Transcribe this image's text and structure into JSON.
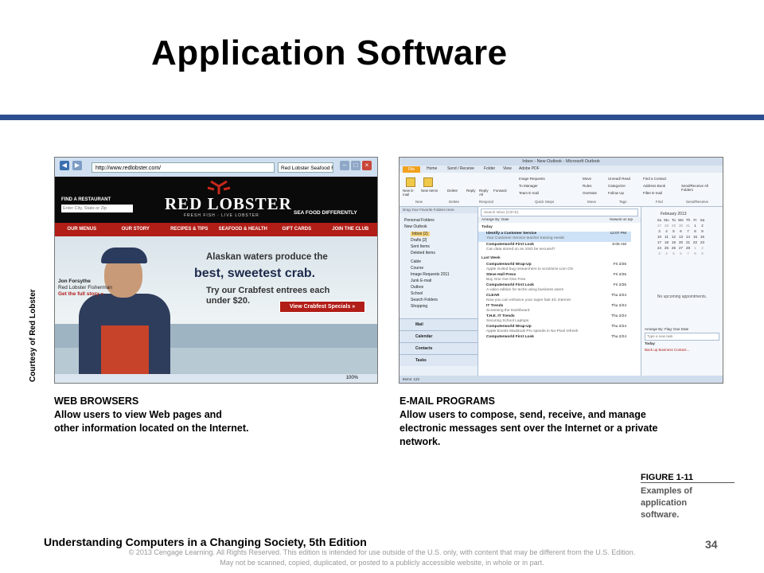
{
  "slide": {
    "title": "Application Software",
    "footer": "Understanding Computers in a Changing Society, 5th Edition",
    "page_number": "34",
    "copyright_line1": "© 2013 Cengage Learning. All Rights Reserved. This edition is intended for use outside of the U.S. only, with content that may be different from the U.S. Edition.",
    "copyright_line2": "May not be scanned, copied, duplicated, or posted to a publicly accessible website, in whole or in part.",
    "credit": "Courtesy of Red Lobster"
  },
  "figure": {
    "label": "FIGURE 1-11",
    "caption_line1": "Examples of",
    "caption_line2": "application",
    "caption_line3": "software."
  },
  "web_browsers": {
    "heading": "WEB BROWSERS",
    "line1": "Allow users to view Web pages and",
    "line2": "other information located on the Internet."
  },
  "email_programs": {
    "heading": "E-MAIL PROGRAMS",
    "line1": "Allow users to compose, send, receive, and manage",
    "line2": "electronic messages sent over the Internet or a private",
    "line3": "network."
  },
  "browser": {
    "address": "http://www.redlobster.com/",
    "tab": "Red Lobster Seafood R...",
    "find_label": "FIND A RESTAURANT",
    "find_placeholder": "Enter City, State or Zip",
    "logo": "RED LOBSTER",
    "logo_sub": "FRESH FISH · LIVE LOBSTER",
    "tagline": "SEA FOOD DIFFERENTLY",
    "nav": [
      "OUR MENUS",
      "OUR STORY",
      "RECIPES & TIPS",
      "SEAFOOD & HEALTH",
      "GIFT CARDS",
      "JOIN THE CLUB"
    ],
    "person_name": "Jon Forsythe",
    "person_role": "Red Lobster Fisherman",
    "person_link": "Get the full story »",
    "quote1": "Alaskan waters produce the",
    "quote2": "best, sweetest crab.",
    "quote3": "Try our Crabfest entrees each",
    "quote4": "under $20.",
    "cta": "View Crabfest Specials »",
    "zoom": "100%"
  },
  "outlook": {
    "title": "Inbox - New Outlook - Microsoft Outlook",
    "tabs": [
      "File",
      "Home",
      "Send / Receive",
      "Folder",
      "View",
      "Adobe PDF"
    ],
    "ribbon_groups": [
      "New",
      "Delete",
      "Respond",
      "Quick Steps",
      "Move",
      "Tags",
      "Find",
      "Send/Receive"
    ],
    "ribbon_buttons": [
      "New E-mail",
      "New Items",
      "Delete",
      "Reply",
      "Reply All",
      "Forward",
      "Image Requests",
      "To Manager",
      "Team E-mail",
      "Move",
      "Rules",
      "OneNote",
      "Unread/ Read",
      "Categorize",
      "Follow Up",
      "Find a Contact",
      "Address Book",
      "Filter E-mail",
      "Send/Receive All Folders"
    ],
    "drag_text": "Drag Your Favorite Folders Here",
    "folders": [
      "Personal Folders",
      "New Outlook",
      "Inbox (2)",
      "Drafts [2]",
      "Sent Items",
      "Deleted Items",
      "Cable",
      "Course",
      "Image Requests 2011",
      "Junk E-mail",
      "Outbox",
      "School",
      "Search Folders",
      "Shopping"
    ],
    "nav_buttons": [
      "Mail",
      "Calendar",
      "Contacts",
      "Tasks"
    ],
    "search_placeholder": "Search Inbox (Ctrl+E)",
    "arrange": "Arrange By: Date",
    "newest": "Newest on top",
    "group_today": "Today",
    "group_last_week": "Last Week",
    "messages": [
      {
        "from": "Identify a Customer Service",
        "date": "12:07 PM",
        "subject": "Your Customer Service teacher training needs"
      },
      {
        "from": "Computerworld First Look",
        "date": "6:05 AM",
        "subject": "Can data stored on an SSD be secured?"
      },
      {
        "from": "Computerworld Wrap-Up",
        "date": "Fri 2/25",
        "subject": "Apple invited bug researchers to scrutinize Lion OS"
      },
      {
        "from": "Steve Hall Press",
        "date": "Fri 2/25",
        "subject": "Buy One Get One Free"
      },
      {
        "from": "Computerworld First Look",
        "date": "Fri 2/25",
        "subject": "A video edition for techs using business users"
      },
      {
        "from": "CLEAR",
        "date": "Thu 2/24",
        "subject": "Now you can enhance your super fast 4G Internet"
      },
      {
        "from": "IT Trends",
        "date": "Thu 2/24",
        "subject": "Screening the Dashboard"
      },
      {
        "from": "T.H.E. IT Trends",
        "date": "Thu 2/24",
        "subject": "Securing School Laptops"
      },
      {
        "from": "Computerworld Wrap-Up",
        "date": "Thu 2/24",
        "subject": "Apple boosts MacBook Pro speeds in No-Pixel refresh"
      },
      {
        "from": "Computerworld First Look",
        "date": "Thu 2/24",
        "subject": ""
      }
    ],
    "cal_month": "February 2013",
    "cal_days": [
      "Su",
      "Mo",
      "Tu",
      "We",
      "Th",
      "Fr",
      "Sa"
    ],
    "cal_dates": [
      "27",
      "28",
      "29",
      "30",
      "31",
      "1",
      "2",
      "3",
      "4",
      "5",
      "6",
      "7",
      "8",
      "9",
      "10",
      "11",
      "12",
      "13",
      "14",
      "15",
      "16",
      "17",
      "18",
      "19",
      "20",
      "21",
      "22",
      "23",
      "24",
      "25",
      "26",
      "27",
      "28",
      "1",
      "2",
      "3",
      "4",
      "5",
      "6",
      "7",
      "8",
      "9"
    ],
    "no_appointments": "No upcoming appointments.",
    "task_arrange": "Arrange By: Flag: Due Date",
    "task_new": "Type a new task",
    "task_today": "Today",
    "task_item": "Back up Business Contact...",
    "status": "Items: 122"
  }
}
